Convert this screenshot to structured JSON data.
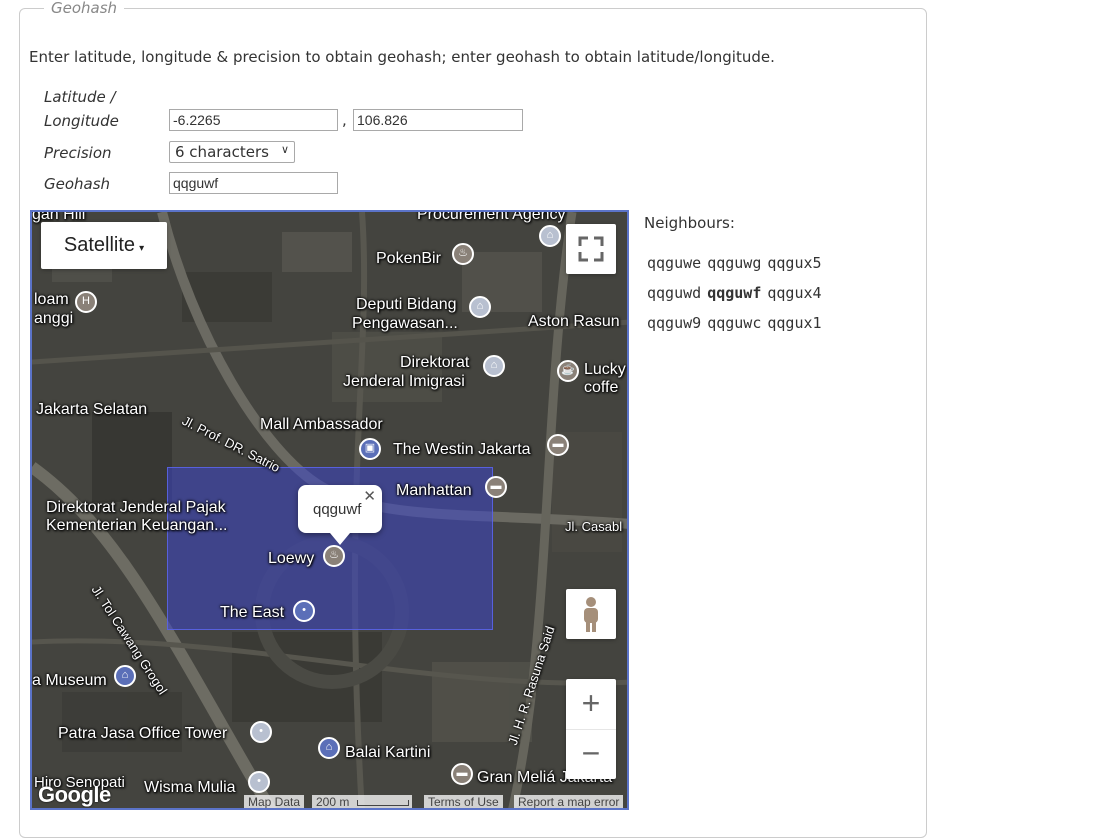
{
  "fieldset": {
    "legend": "Geohash"
  },
  "intro": "Enter latitude, longitude & precision to obtain geohash; enter geohash to obtain latitude/longitude.",
  "form": {
    "latlon_label_1": "Latitude /",
    "latlon_label_2": "Longitude",
    "latitude": "-6.2265",
    "comma": ",",
    "longitude": "106.826",
    "precision_label": "Precision",
    "precision_value": "6 characters",
    "geohash_label": "Geohash",
    "geohash": "qqguwf"
  },
  "map": {
    "type_button": "Satellite",
    "info_window": "qqguwf",
    "close_glyph": "✕",
    "zoom_in": "+",
    "zoom_out": "−",
    "google": "Google",
    "attribution": {
      "map_data": "Map Data",
      "scale": "200 m",
      "terms": "Terms of Use",
      "report": "Report a map error"
    },
    "places": {
      "procurement": "Procurement Agency",
      "gan_hill": "gan Hill",
      "pokenbir": "PokenBir",
      "loam": "loam",
      "anggi": "anggi",
      "deputi1": "Deputi Bidang",
      "deputi2": "Pengawasan...",
      "aston": "Aston Rasun",
      "direktorat1": "Direktorat",
      "direktorat2": "Jenderal Imigrasi",
      "lucky": "Lucky",
      "coffee": "coffe",
      "jaksel": "Jakarta Selatan",
      "prof": "Jl. Prof. DR. Satrio",
      "mall": "Mall Ambassador",
      "westin": "The Westin Jakarta",
      "manhattan": "Manhattan",
      "casabl": "Jl. Casabl",
      "pajak1": "Direktorat Jenderal Pajak",
      "pajak2": "Kementerian Keuangan...",
      "loewy": "Loewy",
      "east": "The East",
      "tol": "Jl. Tol Cawang Grogol",
      "museum": "a Museum",
      "rasuna": "Jl. H. R. Rasuna Said",
      "patra": "Patra Jasa Office Tower",
      "balai": "Balai Kartini",
      "hiro": "Hiro Senopati",
      "wisma": "Wisma Mulia",
      "gran": "Gran Meliá Jakarta"
    }
  },
  "neighbours": {
    "title": "Neighbours:",
    "rows": [
      [
        "qqguwe",
        "qqguwg",
        "qqgux5"
      ],
      [
        "qqguwd",
        "qqguwf",
        "qqgux4"
      ],
      [
        "qqguw9",
        "qqguwc",
        "qqgux1"
      ]
    ]
  },
  "colors": {
    "geohash_fill": "#3c46c8",
    "map_border": "#5b73c8"
  }
}
